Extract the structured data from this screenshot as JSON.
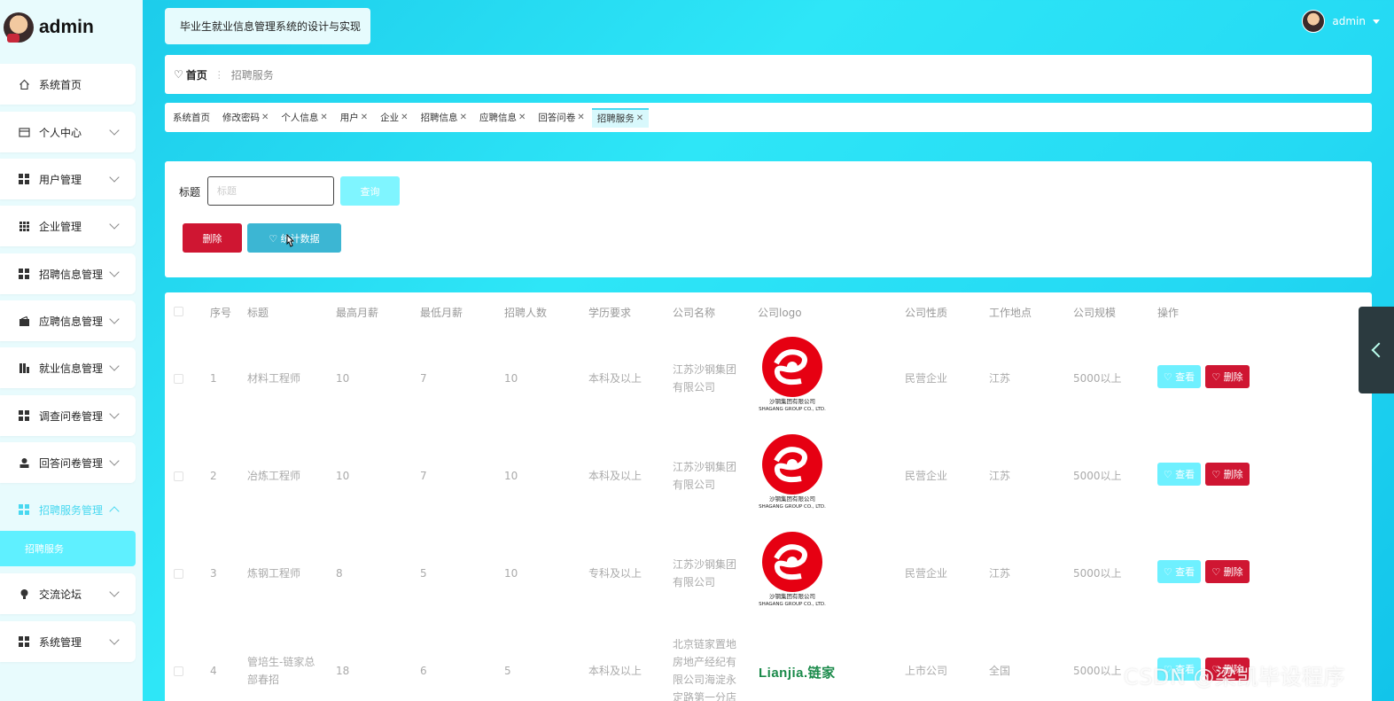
{
  "brand": {
    "name": "admin"
  },
  "sidebar": {
    "items": [
      {
        "label": "系统首页",
        "icon": "home-icon"
      },
      {
        "label": "个人中心",
        "icon": "card-icon"
      },
      {
        "label": "用户管理",
        "icon": "grid-icon"
      },
      {
        "label": "企业管理",
        "icon": "grid9-icon"
      },
      {
        "label": "招聘信息管理",
        "icon": "grid-icon"
      },
      {
        "label": "应聘信息管理",
        "icon": "wallet-icon"
      },
      {
        "label": "就业信息管理",
        "icon": "chart-icon"
      },
      {
        "label": "调查问卷管理",
        "icon": "grid-icon"
      },
      {
        "label": "回答问卷管理",
        "icon": "user-icon"
      },
      {
        "label": "招聘服务管理",
        "icon": "grid-icon"
      },
      {
        "label": "交流论坛",
        "icon": "bulb-icon"
      },
      {
        "label": "系统管理",
        "icon": "grid-icon"
      }
    ],
    "submenu": {
      "label": "招聘服务"
    }
  },
  "header": {
    "system_title": "毕业生就业信息管理系统的设计与实现",
    "user": "admin"
  },
  "breadcrumb": {
    "home": "首页",
    "current": "招聘服务"
  },
  "tags": [
    "系统首页",
    "修改密码",
    "个人信息",
    "用户",
    "企业",
    "招聘信息",
    "应聘信息",
    "回答问卷",
    "招聘服务"
  ],
  "search": {
    "label": "标题",
    "placeholder": "标题",
    "query_btn": "查询",
    "delete_btn": "删除",
    "stats_btn": "统计数据"
  },
  "table": {
    "headers": [
      "序号",
      "标题",
      "最高月薪",
      "最低月薪",
      "招聘人数",
      "学历要求",
      "公司名称",
      "公司logo",
      "公司性质",
      "工作地点",
      "公司规模",
      "操作"
    ],
    "rows": [
      {
        "no": "1",
        "title": "材料工程师",
        "max": "10",
        "min": "7",
        "count": "10",
        "edu": "本科及以上",
        "company1": "江苏沙钢集团",
        "company2": "有限公司",
        "company3": "",
        "company4": "",
        "logo": "shagang",
        "nature": "民营企业",
        "location": "江苏",
        "scale": "5000以上"
      },
      {
        "no": "2",
        "title": "冶炼工程师",
        "max": "10",
        "min": "7",
        "count": "10",
        "edu": "本科及以上",
        "company1": "江苏沙钢集团",
        "company2": "有限公司",
        "company3": "",
        "company4": "",
        "logo": "shagang",
        "nature": "民营企业",
        "location": "江苏",
        "scale": "5000以上"
      },
      {
        "no": "3",
        "title": "炼钢工程师",
        "max": "8",
        "min": "5",
        "count": "10",
        "edu": "专科及以上",
        "company1": "江苏沙钢集团",
        "company2": "有限公司",
        "company3": "",
        "company4": "",
        "logo": "shagang",
        "nature": "民营企业",
        "location": "江苏",
        "scale": "5000以上"
      },
      {
        "no": "4",
        "title": "管培生-链家总",
        "title2": "部春招",
        "max": "18",
        "min": "6",
        "count": "5",
        "edu": "本科及以上",
        "company1": "北京链家置地",
        "company2": "房地产经纪有",
        "company3": "限公司海淀永",
        "company4": "定路第一分店",
        "logo": "lianjia",
        "nature": "上市公司",
        "location": "全国",
        "scale": "5000以上"
      }
    ],
    "view_btn": "查看",
    "delete_btn": "删除",
    "shagang_logo_text": [
      "沙钢集团有限公司",
      "SHAGANG GROUP CO., LTD."
    ],
    "lianjia_logo_text": "Lianjia.链家"
  },
  "watermark": "CSDN @梁凯毕设程序"
}
